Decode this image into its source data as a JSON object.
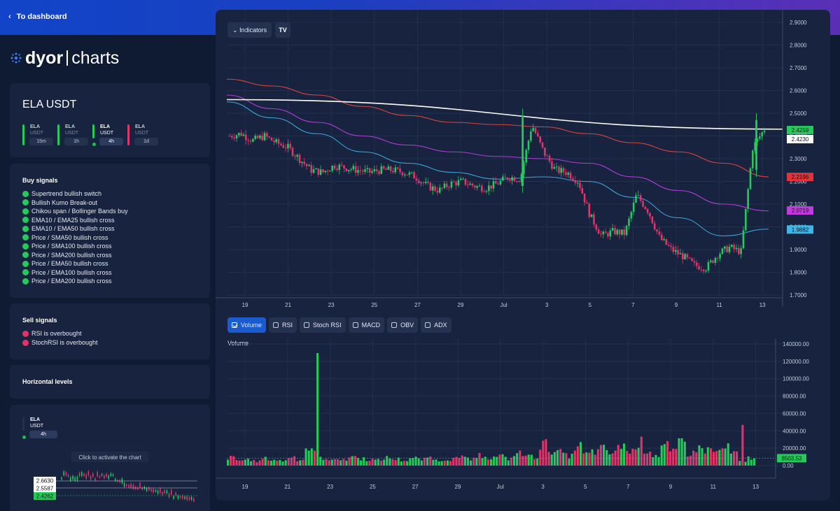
{
  "topbar": {
    "dashboard_label": "To dashboard"
  },
  "logo": {
    "brand": "dyor",
    "product": "charts"
  },
  "pair": {
    "title": "ELA USDT",
    "timeframes": [
      {
        "symbol": "ELA",
        "quote": "USDT",
        "label": "15m",
        "color": "#26c95a",
        "active": false
      },
      {
        "symbol": "ELA",
        "quote": "USDT",
        "label": "1h",
        "color": "#26c95a",
        "active": false
      },
      {
        "symbol": "ELA",
        "quote": "USDT",
        "label": "4h",
        "color": "#26c95a",
        "active": true
      },
      {
        "symbol": "ELA",
        "quote": "USDT",
        "label": "1d",
        "color": "#e0346a",
        "active": false
      }
    ]
  },
  "buy_signals": {
    "title": "Buy signals",
    "items": [
      "Supertrend bullish switch",
      "Bullish Kumo Break-out",
      "Chikou span / Bollinger Bands buy",
      "EMA10 / EMA25 bullish cross",
      "EMA10 / EMA50 bullish cross",
      "Price / SMA50 bullish cross",
      "Price / SMA100 bullish cross",
      "Price / SMA200 bullish cross",
      "Price / EMA50 bullish cross",
      "Price / EMA100 bullish cross",
      "Price / EMA200 bullish cross"
    ]
  },
  "sell_signals": {
    "title": "Sell signals",
    "items": [
      "RSI is overbought",
      "StochRSI is overbought"
    ]
  },
  "horizontal_levels": {
    "title": "Horizontal levels"
  },
  "mini": {
    "symbol": "ELA",
    "quote": "USDT",
    "timeframe": "4h",
    "activate_label": "Click to activate the chart",
    "levels": [
      "2.6630",
      "2.5587",
      "2.4262"
    ]
  },
  "toolbar": {
    "indicators_label": "Indicators",
    "tv_label": "TV"
  },
  "tabs": [
    {
      "label": "Volume",
      "checked": true
    },
    {
      "label": "RSI",
      "checked": false
    },
    {
      "label": "Stoch RSI",
      "checked": false
    },
    {
      "label": "MACD",
      "checked": false
    },
    {
      "label": "OBV",
      "checked": false
    },
    {
      "label": "ADX",
      "checked": false
    }
  ],
  "volume_title": "Volume",
  "chart_data": [
    {
      "type": "candlestick",
      "x_ticks": [
        "19",
        "21",
        "23",
        "25",
        "27",
        "29",
        "Jul",
        "3",
        "5",
        "7",
        "9",
        "11",
        "13"
      ],
      "y_ticks": [
        "2.9000",
        "2.8000",
        "2.7000",
        "2.6000",
        "2.5000",
        "2.4000",
        "2.3000",
        "2.2000",
        "2.1000",
        "2.0000",
        "1.9000",
        "1.8000",
        "1.7000"
      ],
      "ylim": [
        1.7,
        2.9
      ],
      "price_labels": [
        {
          "value": "2.4259",
          "color": "#26c95a"
        },
        {
          "value": "2.4230",
          "color": "#ffffff"
        },
        {
          "value": "2.2196",
          "color": "#e0343a"
        },
        {
          "value": "2.0719",
          "color": "#c33be0"
        },
        {
          "value": "1.9882",
          "color": "#3fb6e8"
        }
      ],
      "close_path": [
        2.4,
        2.41,
        2.38,
        2.4,
        2.37,
        2.35,
        2.3,
        2.25,
        2.24,
        2.27,
        2.26,
        2.25,
        2.24,
        2.25,
        2.25,
        2.24,
        2.22,
        2.18,
        2.16,
        2.19,
        2.2,
        2.18,
        2.17,
        2.19,
        2.22,
        2.21,
        2.45,
        2.33,
        2.25,
        2.24,
        2.2,
        2.05,
        1.96,
        1.98,
        1.97,
        2.14,
        2.07,
        1.95,
        1.9,
        1.87,
        1.83,
        1.82,
        1.88,
        1.91,
        1.89,
        2.35,
        2.43
      ],
      "series": [
        {
          "name": "",
          "color": "#d9443e",
          "values": [
            2.65,
            2.62,
            2.58,
            2.53,
            2.49,
            2.46,
            2.45,
            2.44,
            2.41,
            2.37,
            2.33,
            2.28,
            2.22
          ]
        },
        {
          "name": "",
          "color": "#b03cd8",
          "values": [
            2.58,
            2.52,
            2.46,
            2.4,
            2.36,
            2.33,
            2.31,
            2.3,
            2.28,
            2.22,
            2.16,
            2.1,
            2.07
          ]
        },
        {
          "name": "",
          "color": "#3aa7d8",
          "values": [
            2.55,
            2.48,
            2.41,
            2.33,
            2.28,
            2.24,
            2.21,
            2.22,
            2.2,
            2.13,
            2.04,
            1.96,
            1.99
          ]
        },
        {
          "name": "",
          "color": "#ffffff",
          "values": [
            2.56,
            2.43
          ]
        }
      ]
    },
    {
      "type": "bar",
      "title": "Volume",
      "x_ticks": [
        "19",
        "21",
        "23",
        "25",
        "27",
        "29",
        "Jul",
        "3",
        "5",
        "7",
        "9",
        "11",
        "13"
      ],
      "y_ticks": [
        "140000.00",
        "120000.00",
        "100000.00",
        "80000.00",
        "60000.00",
        "40000.00",
        "20000.00",
        "0.00"
      ],
      "ylim": [
        0,
        140000
      ],
      "last_label": "8503.53",
      "values": [
        9000,
        6000,
        7000,
        5000,
        8000,
        6500,
        5500,
        10000,
        7000,
        20000,
        115000,
        6000,
        9000,
        6000,
        11000,
        8000,
        7000,
        6000,
        9000,
        7500,
        6000,
        8500,
        7000,
        9500,
        6000,
        7500,
        8000,
        9000,
        7000,
        12000,
        9000,
        11000,
        8000,
        14000,
        12000,
        10000,
        24000,
        18000,
        15000,
        11000,
        22000,
        13000,
        16000,
        19000,
        14000,
        24000,
        16000,
        26000,
        18000,
        12000,
        22000,
        15000,
        28000,
        14000,
        20000,
        18000,
        16000,
        20000,
        14000,
        38000,
        9000
      ]
    }
  ]
}
